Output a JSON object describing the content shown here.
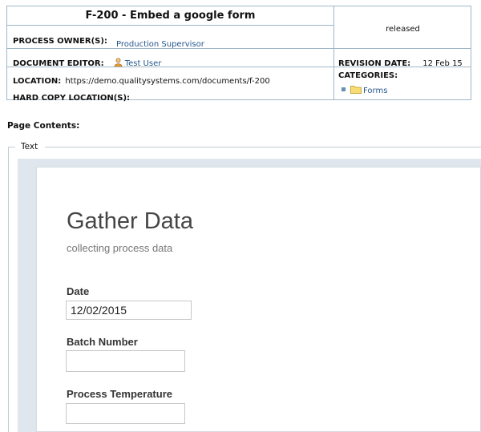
{
  "header": {
    "title": "F-200 - Embed a google form",
    "status": "released",
    "process_owner": {
      "label": "PROCESS OWNER(S):",
      "value": "Production Supervisor"
    },
    "document_editor": {
      "label": "DOCUMENT EDITOR:",
      "value": "Test User",
      "icon": "user-icon"
    },
    "revision_date": {
      "label": "REVISION DATE:",
      "value": "12 Feb 15"
    },
    "location": {
      "label": "LOCATION:",
      "value": "https://demo.qualitysystems.com/documents/f-200"
    },
    "hard_copy_location": {
      "label": "HARD COPY LOCATION(S):",
      "value": ""
    },
    "categories": {
      "label": "CATEGORIES:",
      "items": [
        "Forms"
      ],
      "icon": "folder-icon"
    }
  },
  "page_contents_label": "Page Contents:",
  "section_legend": "Text",
  "form": {
    "title": "Gather Data",
    "description": "collecting process data",
    "questions": [
      {
        "label": "Date",
        "value": "12/02/2015"
      },
      {
        "label": "Batch Number",
        "value": ""
      },
      {
        "label": "Process Temperature",
        "value": ""
      }
    ]
  },
  "colors": {
    "border": "#9fb6c6",
    "link": "#24568c",
    "embed_background": "#dfe6ee"
  }
}
